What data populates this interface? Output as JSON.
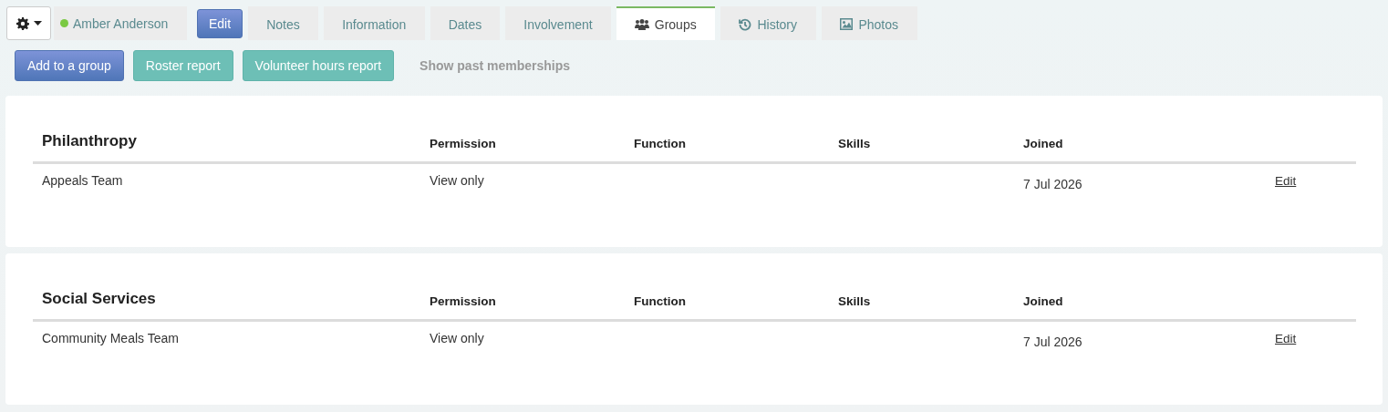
{
  "person": {
    "name": "Amber Anderson",
    "online": true
  },
  "edit_button": "Edit",
  "tabs": [
    {
      "label": "Notes",
      "selected": false
    },
    {
      "label": "Information",
      "selected": false
    },
    {
      "label": "Dates",
      "selected": false
    },
    {
      "label": "Involvement",
      "selected": false
    },
    {
      "label": "Groups",
      "selected": true
    },
    {
      "label": "History",
      "selected": false
    },
    {
      "label": "Photos",
      "selected": false
    }
  ],
  "actions": [
    {
      "label": "Add to a group",
      "kind": "primary"
    },
    {
      "label": "Roster report",
      "kind": "secondary"
    },
    {
      "label": "Volunteer hours report",
      "kind": "secondary"
    },
    {
      "label": "Show past memberships",
      "kind": "link"
    }
  ],
  "cards": [
    {
      "title": "Philanthropy",
      "columns": [
        "Permission",
        "Function",
        "Skills",
        "Joined"
      ],
      "rows": [
        {
          "name": "Appeals Team",
          "permission": "View only",
          "joined": "7 Jul 2026",
          "action": "Edit"
        }
      ]
    },
    {
      "title": "Social Services",
      "columns": [
        "Permission",
        "Function",
        "Skills",
        "Joined"
      ],
      "rows": [
        {
          "name": "Community Meals Team",
          "permission": "View only",
          "joined": "7 Jul 2026",
          "action": "Edit"
        }
      ]
    }
  ]
}
